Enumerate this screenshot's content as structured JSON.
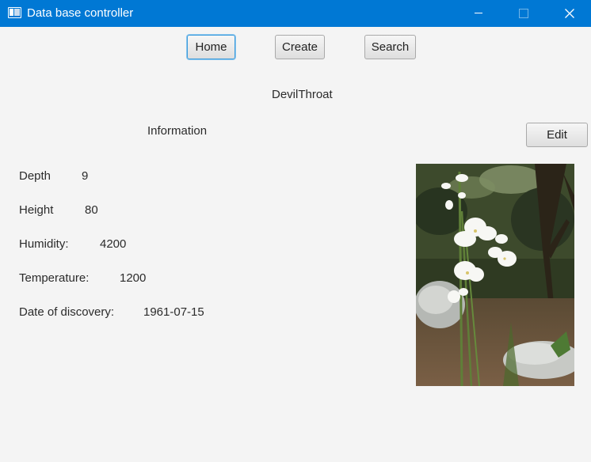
{
  "window": {
    "title": "Data base controller"
  },
  "nav": {
    "home_label": "Home",
    "create_label": "Create",
    "search_label": "Search"
  },
  "record": {
    "name": "DevilThroat",
    "section_title": "Information",
    "edit_label": "Edit",
    "fields": [
      {
        "label": "Depth",
        "value": "9"
      },
      {
        "label": "Height",
        "value": "80"
      },
      {
        "label": "Humidity:",
        "value": "4200"
      },
      {
        "label": "Temperature:",
        "value": "1200"
      },
      {
        "label": "Date of discovery:",
        "value": "1961-07-15"
      }
    ]
  },
  "colors": {
    "titlebar": "#0078d4",
    "background": "#f4f4f4",
    "focus": "#3a9bdc"
  }
}
